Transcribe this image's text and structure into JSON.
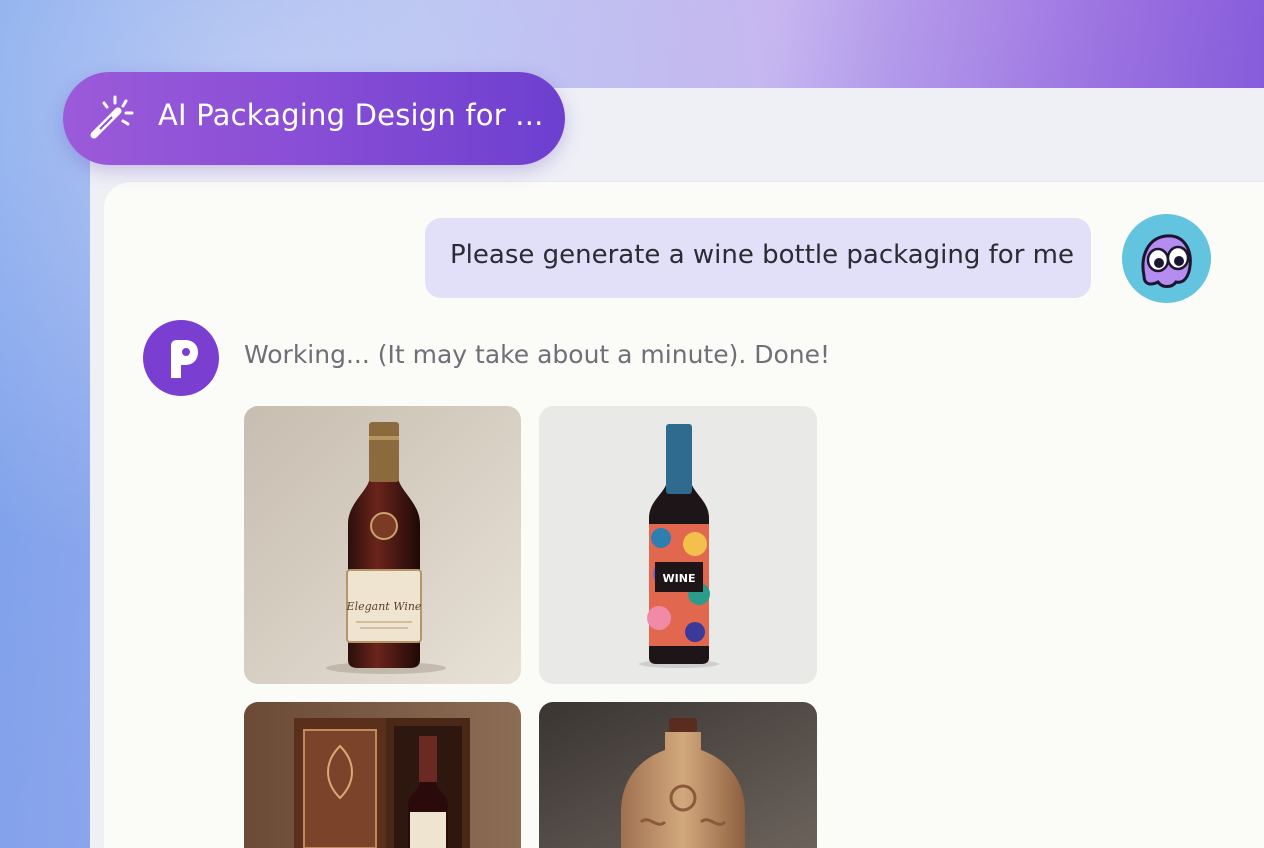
{
  "header": {
    "title": "AI Packaging Design for ...",
    "icon": "magic-wand-icon",
    "gradient": [
      "#9b5ad9",
      "#6d3fcf"
    ]
  },
  "chat": {
    "user_message": "Please generate a wine bottle packaging for me",
    "user_bubble_color": "#e2e0f9",
    "bot_status": "Working... (It may take about a minute). Done!",
    "bot_avatar_color": "#7a3fd0",
    "user_avatar_color": "#62c4df"
  },
  "results": {
    "images": [
      {
        "name": "classic-wine-bottle-image",
        "label_text": "Elegant Wine"
      },
      {
        "name": "patterned-wine-bottle-image",
        "label_text": "WINE"
      },
      {
        "name": "wooden-gift-box-wine-image"
      },
      {
        "name": "ceramic-wine-flask-image"
      }
    ]
  }
}
